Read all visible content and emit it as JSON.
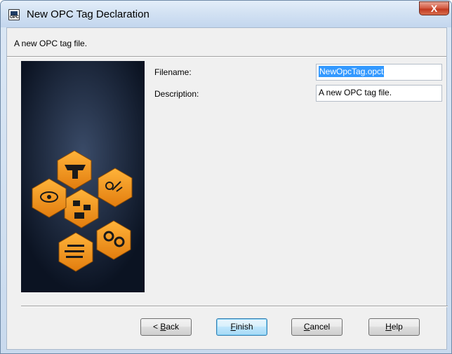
{
  "window": {
    "title": "New OPC Tag Declaration",
    "close_glyph": "X",
    "icon_text": "OPC"
  },
  "header": {
    "description": "A new OPC tag file."
  },
  "form": {
    "filename_label": "Filename:",
    "filename_value": "NewOpcTag.opct",
    "description_label": "Description:",
    "description_value": "A new OPC tag file."
  },
  "buttons": {
    "back": {
      "mnemonic": "B",
      "rest": "ack",
      "prefix": "< "
    },
    "finish": {
      "mnemonic": "F",
      "rest": "inish"
    },
    "cancel": {
      "mnemonic": "C",
      "rest": "ancel"
    },
    "help": {
      "mnemonic": "H",
      "rest": "elp"
    }
  },
  "colors": {
    "accent_orange": "#f39a1c",
    "selection_blue": "#3399ff",
    "panel_dark": "#0d1626"
  },
  "icons": [
    "opc-app-icon",
    "close-icon",
    "hardware-icon",
    "tools-icon",
    "monitor-eye-icon",
    "network-icon",
    "binary-icon",
    "gears-icon"
  ]
}
